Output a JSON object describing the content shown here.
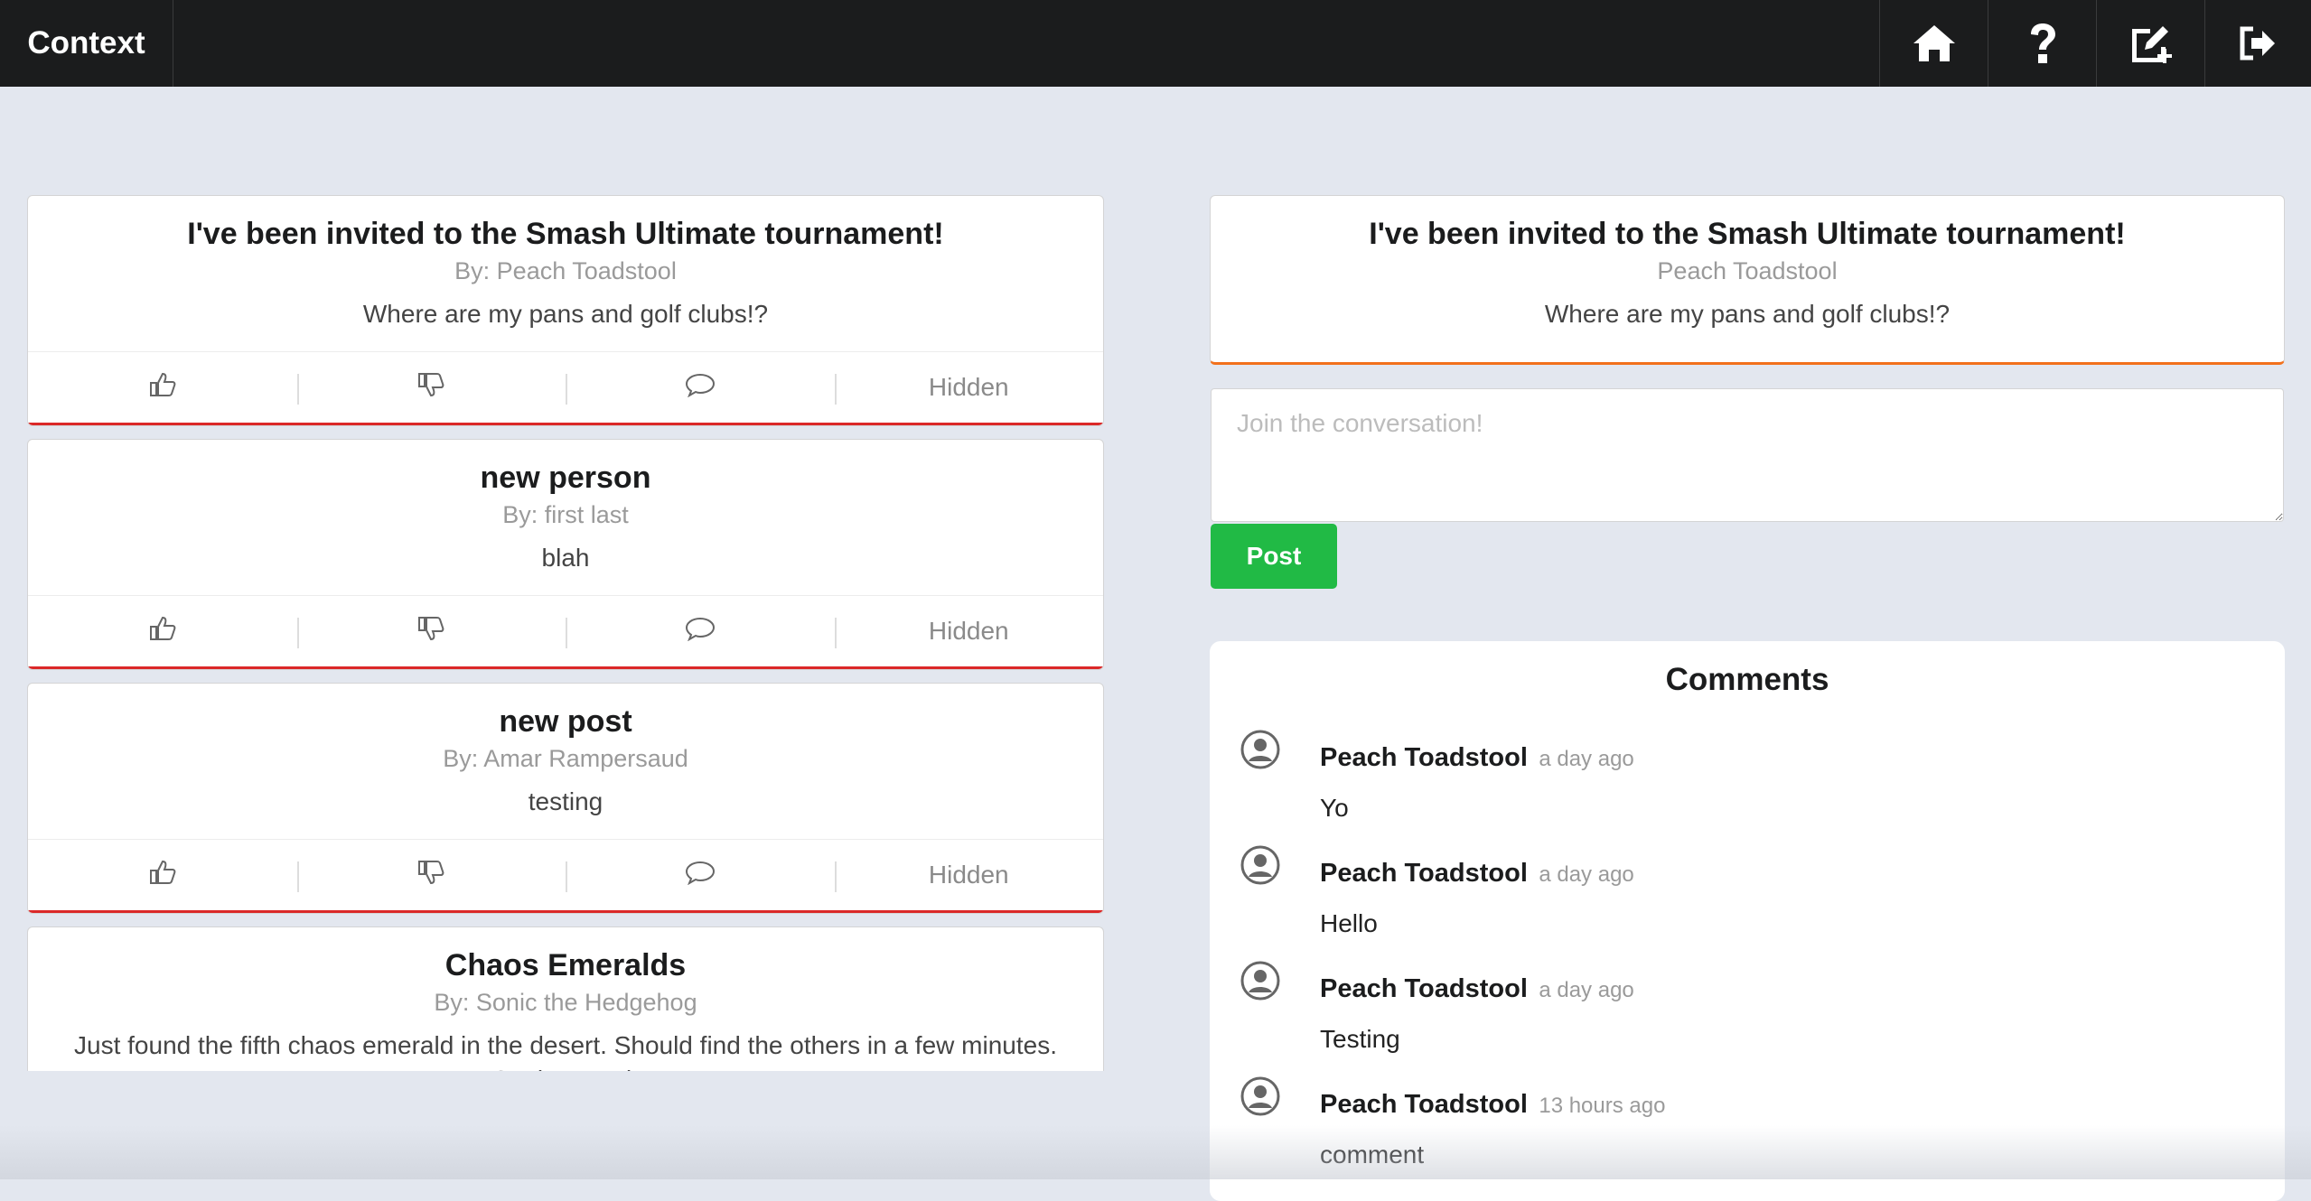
{
  "navbar": {
    "brand": "Context",
    "icons": [
      "home-icon",
      "help-icon",
      "new-post-icon",
      "logout-icon"
    ]
  },
  "feed": [
    {
      "title": "I've been invited to the Smash Ultimate tournament!",
      "author": "By: Peach Toadstool",
      "body": "Where are my pans and golf clubs!?",
      "status": "Hidden"
    },
    {
      "title": "new person",
      "author": "By: first last",
      "body": "blah",
      "status": "Hidden"
    },
    {
      "title": "new post",
      "author": "By: Amar Rampersaud",
      "body": "testing",
      "status": "Hidden"
    },
    {
      "title": "Chaos Emeralds",
      "author": "By: Sonic the Hedgehog",
      "body": "Just found the fifth chaos emerald in the desert. Should find the others in a few minutes. Sonic speed!"
    }
  ],
  "detail": {
    "title": "I've been invited to the Smash Ultimate tournament!",
    "author": "Peach Toadstool",
    "body": "Where are my pans and golf clubs!?"
  },
  "reply": {
    "placeholder": "Join the conversation!",
    "button": "Post"
  },
  "comments": {
    "heading": "Comments",
    "items": [
      {
        "name": "Peach Toadstool",
        "time": "a day ago",
        "text": "Yo"
      },
      {
        "name": "Peach Toadstool",
        "time": "a day ago",
        "text": "Hello"
      },
      {
        "name": "Peach Toadstool",
        "time": "a day ago",
        "text": "Testing"
      },
      {
        "name": "Peach Toadstool",
        "time": "13 hours ago",
        "text": "comment"
      }
    ]
  },
  "colors": {
    "navbar": "#1b1c1d",
    "background": "#e3e7ef",
    "hidden_accent": "#db2828",
    "selected_accent": "#f2711c",
    "post_button": "#21ba45"
  }
}
